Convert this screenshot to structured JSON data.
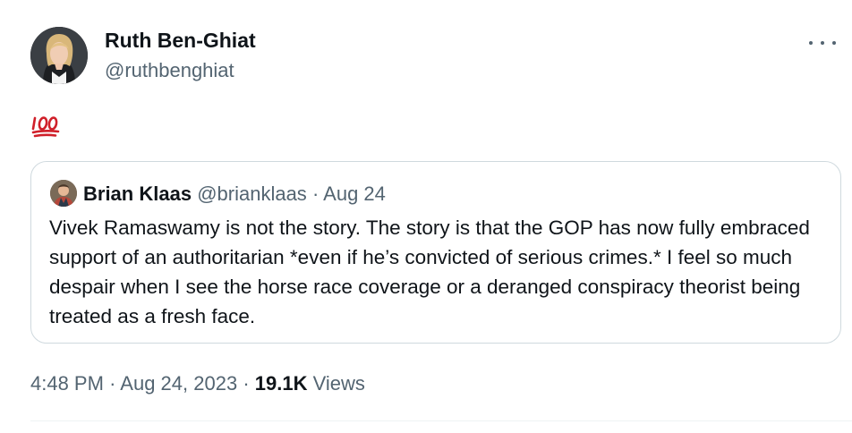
{
  "tweet": {
    "author": {
      "name": "Ruth Ben-Ghiat",
      "handle": "@ruthbenghiat"
    },
    "text_emoji": "hundred-points-emoji",
    "quoted": {
      "name": "Brian Klaas",
      "handle": "@brianklaas",
      "separator": "·",
      "date": "Aug 24",
      "text": "Vivek Ramaswamy is not the story. The story is that the GOP has now fully embraced support of an authoritarian *even if he’s convicted of serious crimes.* I feel so much despair when I see the horse race coverage or a deranged conspiracy theorist being treated as a fresh face."
    },
    "meta": {
      "time": "4:48 PM",
      "separator": "·",
      "date": "Aug 24, 2023",
      "views_count": "19.1K",
      "views_label": "Views"
    }
  },
  "icons": {
    "more": "more-horizontal-icon",
    "emoji": "hundred-points-emoji"
  },
  "colors": {
    "text_primary": "#0f1419",
    "text_secondary": "#536471",
    "border": "#cfd9de",
    "emoji_red": "#d0202a"
  }
}
